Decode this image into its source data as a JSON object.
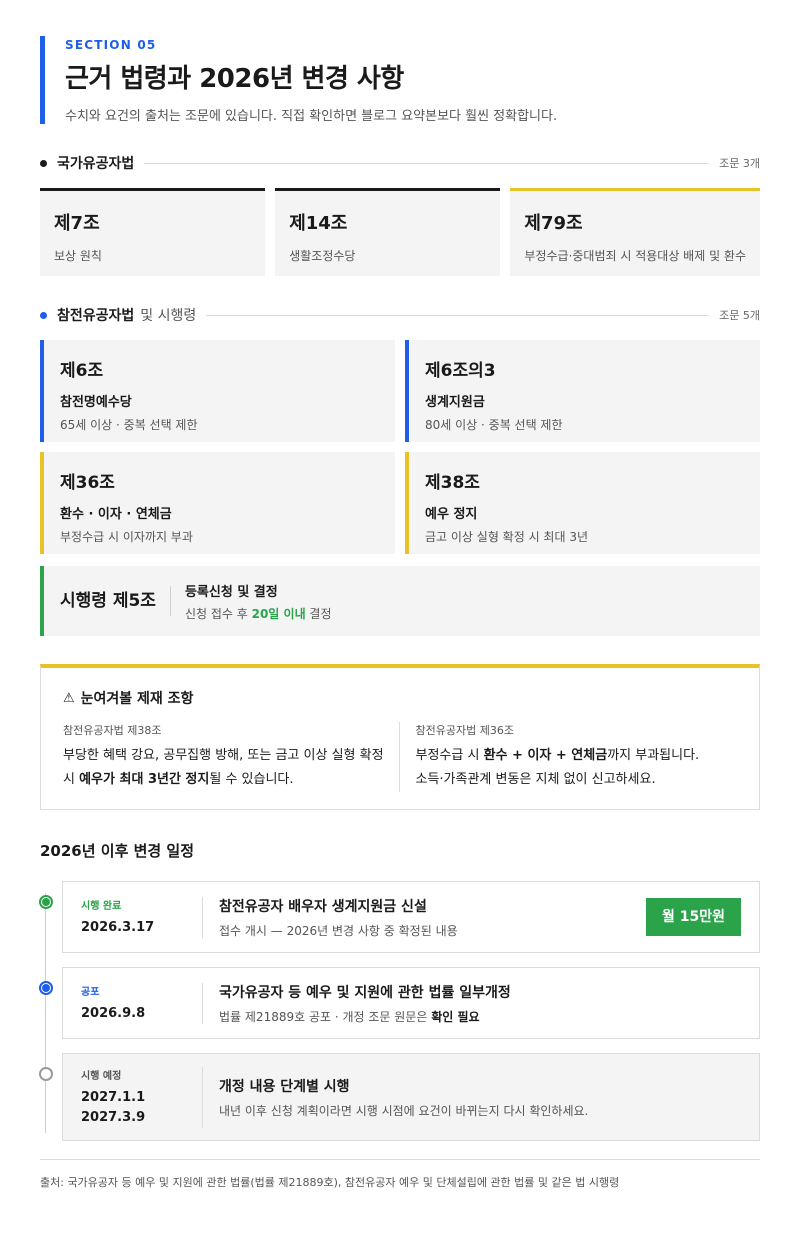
{
  "header": {
    "eyebrow": "SECTION 05",
    "title": "근거 법령과 2026년 변경 사항",
    "subtitle": "수치와 요건의 출처는 조문에 있습니다. 직접 확인하면 블로그 요약본보다 훨씬 정확합니다."
  },
  "law1": {
    "name": "국가유공자법",
    "count": "조문 3개",
    "articles": [
      {
        "article": "제7조",
        "desc": "보상 원칙"
      },
      {
        "article": "제14조",
        "desc": "생활조정수당"
      },
      {
        "article": "제79조",
        "desc": "부정수급·중대범죄 시 적용대상 배제 및 환수"
      }
    ]
  },
  "law2": {
    "name": "참전유공자법",
    "name_suffix": "및 시행령",
    "count": "조문 5개",
    "articles": [
      {
        "article": "제6조",
        "head": "참전명예수당",
        "desc": "65세 이상 · 중복 선택 제한"
      },
      {
        "article": "제6조의3",
        "head": "생계지원금",
        "desc": "80세 이상 · 중복 선택 제한"
      },
      {
        "article": "제36조",
        "head": "환수 · 이자 · 연체금",
        "desc": "부정수급 시 이자까지 부과"
      },
      {
        "article": "제38조",
        "head": "예우 정지",
        "desc": "금고 이상 실형 확정 시 최대 3년"
      }
    ],
    "decree": {
      "article": "시행령 제5조",
      "head": "등록신청 및 결정",
      "desc_pre": "신청 접수 후 ",
      "desc_hl": "20일 이내",
      "desc_post": " 결정"
    }
  },
  "warning": {
    "icon": "warning-icon",
    "title": "눈여겨볼 제재 조항",
    "left": {
      "ref": "참전유공자법 제38조",
      "t1": "부당한 혜택 강요, 공무집행 방해, 또는 금고 이상 실형 확정 시 ",
      "b1": "예우가 최대 3년간 정지",
      "t2": "될 수 있습니다."
    },
    "right": {
      "ref": "참전유공자법 제36조",
      "t1": "부정수급 시 ",
      "b1": "환수 + 이자 + 연체금",
      "t2": "까지 부과됩니다.",
      "t3": "소득·가족관계 변동은 지체 없이 신고하세요."
    }
  },
  "timeline": {
    "title": "2026년 이후 변경 일정",
    "items": [
      {
        "status": "시행 완료",
        "date": "2026.3.17",
        "head": "참전유공자 배우자 생계지원금 신설",
        "desc": "접수 개시 — 2026년 변경 사항 중 확정된 내용",
        "badge": "월 15만원"
      },
      {
        "status": "공포",
        "date": "2026.9.8",
        "head": "국가유공자 등 예우 및 지원에 관한 법률 일부개정",
        "desc_pre": "법률 제21889호 공포 · 개정 조문 원문은 ",
        "desc_b": "확인 필요"
      },
      {
        "status": "시행 예정",
        "date1": "2027.1.1",
        "date2": "2027.3.9",
        "head": "개정 내용 단계별 시행",
        "desc": "내년 이후 신청 계획이라면 시행 시점에 요건이 바뀌는지 다시 확인하세요."
      }
    ]
  },
  "colors": {
    "blue": "#1f5ee8",
    "yellow": "#e8c227",
    "green": "#2aa34a",
    "gray": "#9a9a9a"
  },
  "footer": "출처: 국가유공자 등 예우 및 지원에 관한 법률(법률 제21889호), 참전유공자 예우 및 단체설립에 관한 법률 및 같은 법 시행령"
}
